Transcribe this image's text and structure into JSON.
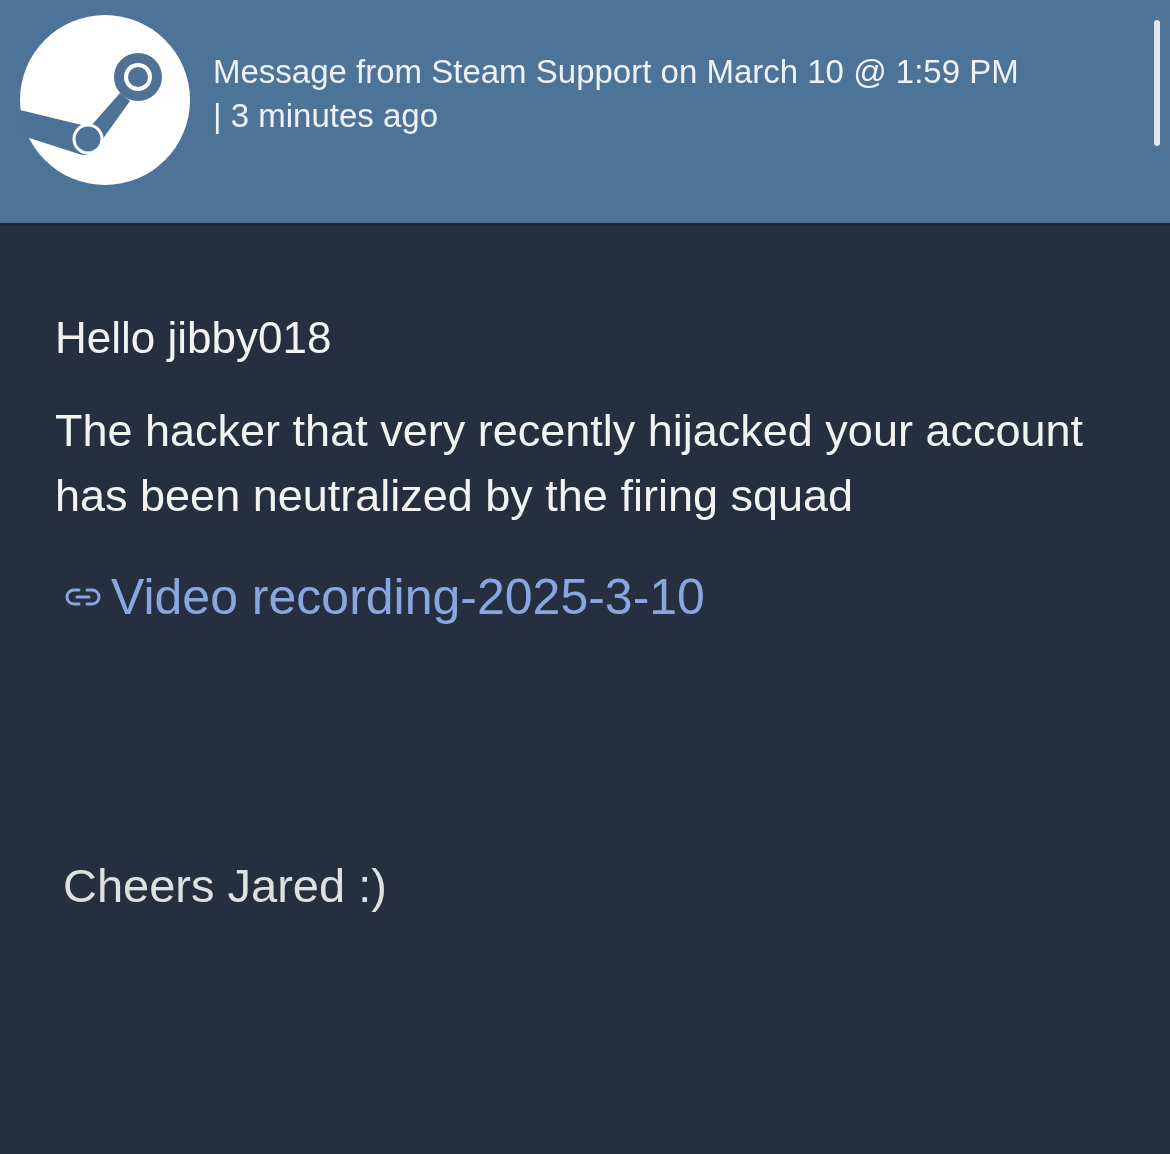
{
  "header": {
    "title": "Message from Steam Support on March 10 @ 1:59 PM | 3 minutes ago"
  },
  "message": {
    "greeting": "Hello jibby018",
    "body": "The hacker that very recently hijacked your account has been neutralized by the firing squad",
    "link": "Video recording-2025-3-10",
    "signoff": "Cheers Jared :)"
  }
}
